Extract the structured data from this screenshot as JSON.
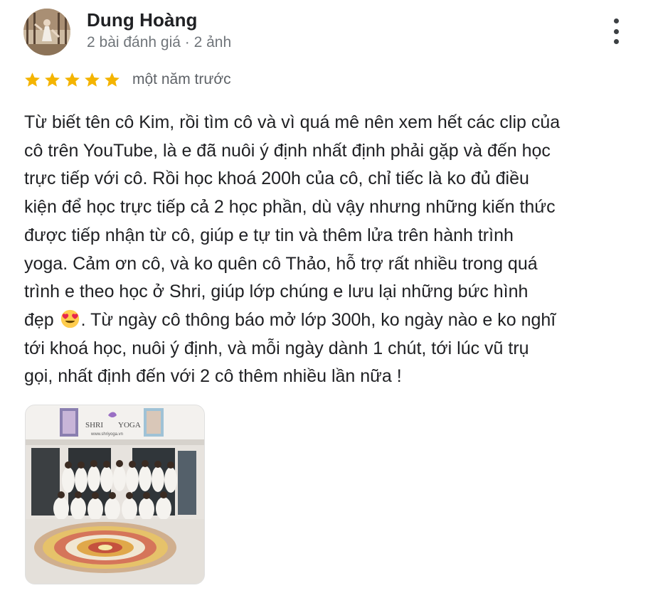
{
  "reviewer": {
    "name": "Dung Hoàng",
    "meta": "2 bài đánh giá · 2 ảnh"
  },
  "rating": {
    "stars": 5,
    "max": 5,
    "color": "#f4b400",
    "time": "một năm trước"
  },
  "review": {
    "lines": [
      "Từ biết tên cô Kim, rồi tìm cô và vì quá mê nên xem hết các clip của",
      "cô trên YouTube, là e đã nuôi ý định nhất định phải gặp và đến học",
      "trực tiếp với cô. Rồi học khoá 200h của cô, chỉ tiếc là ko đủ điều",
      "kiện để học trực tiếp cả 2 học phần, dù vậy nhưng những kiến thức",
      "được tiếp nhận từ cô, giúp e tự tin và thêm lửa trên hành trình",
      "yoga. Cảm ơn cô, và ko quên cô Thảo, hỗ trợ rất nhiều trong quá",
      "trình e theo học ở Shri, giúp lớp chúng e lưu lại những bức hình",
      "đẹp",
      ". Từ ngày cô thông báo mở lớp 300h, ko ngày nào e ko nghĩ",
      "tới khoá học, nuôi ý định, và mỗi ngày dành 1 chút, tới lúc vũ trụ",
      "gọi, nhất định đến với 2 cô thêm nhiều lần nữa !"
    ],
    "emoji": "heart-eyes-emoji"
  },
  "photo": {
    "sign_left": "SHRI",
    "sign_right": "YOGA",
    "sign_url": "www.shriyoga.vn"
  },
  "icons": {
    "more": "more-vert-icon",
    "star": "star-icon"
  }
}
